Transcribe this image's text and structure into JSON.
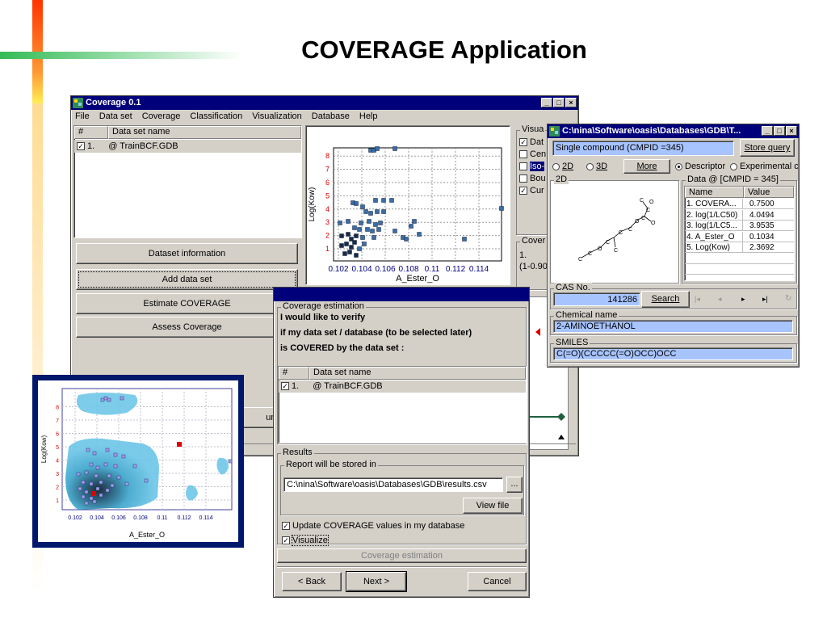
{
  "slide": {
    "title": "COVERAGE Application"
  },
  "main_window": {
    "title": "Coverage 0.1",
    "menu": [
      "File",
      "Data set",
      "Coverage",
      "Classification",
      "Visualization",
      "Database",
      "Help"
    ],
    "table": {
      "col_num": "#",
      "col_name": "Data set name",
      "row_num": "1.",
      "row_name": "@ TrainBCF.GDB"
    },
    "buttons": [
      "Dataset information",
      "Add data set",
      "Estimate COVERAGE",
      "Assess Coverage"
    ],
    "boundaries_text": "undarie",
    "plot": {
      "xlabel": "A_Ester_O",
      "ylabel": "Log(Kow)",
      "x_ticks": [
        "0.102",
        "0.104",
        "0.106",
        "0.108",
        "0.11",
        "0.112",
        "0.114"
      ],
      "y_ticks": [
        "1",
        "2",
        "3",
        "4",
        "5",
        "6",
        "7",
        "8"
      ]
    },
    "visual_panel": {
      "label": "Visua",
      "items": [
        {
          "label": "Dat",
          "checked": true
        },
        {
          "label": "Cen",
          "checked": false
        },
        {
          "label": "Iso-",
          "checked": false
        },
        {
          "label": "Bou",
          "checked": false
        },
        {
          "label": "Cur",
          "checked": true
        }
      ]
    },
    "coverage_panel": {
      "label": "Cover",
      "line1": "1.",
      "line2": "(1-0.90)"
    }
  },
  "compound_window": {
    "title": "C:\\nina\\Software\\oasis\\Databases\\GDB\\T...",
    "compound_field": "Single compound (CMPID =345)",
    "store_query": "Store query",
    "radio_2d": "2D",
    "radio_3d": "3D",
    "more": "More",
    "radio_descriptor": "Descriptor",
    "radio_experimental": "Experimental c",
    "group_2d": "2D",
    "data_group": "Data @ [CMPID = 345]",
    "data_headers": [
      "Name",
      "Value"
    ],
    "data_rows": [
      {
        "name": "1. COVERA...",
        "value": "0.7500"
      },
      {
        "name": "2. log(1/LC50)",
        "value": "4.0494"
      },
      {
        "name": "3. log(1/LC5...",
        "value": "3.9535"
      },
      {
        "name": "4. A_Ester_O",
        "value": "0.1034"
      },
      {
        "name": "5. Log(Kow)",
        "value": "2.3692"
      }
    ],
    "cas_label": "CAS No.",
    "cas_value": "141286",
    "search": "Search",
    "chem_label": "Chemical name",
    "chem_value": "2-AMINOETHANOL",
    "smiles_label": "SMILES",
    "smiles_value": "C(=O)(CCCCC(=O)OCC)OCC",
    "molecule_atoms": [
      "C",
      "C",
      "O",
      "C",
      "C",
      "C",
      "C",
      "O",
      "C",
      "O",
      "C",
      "C",
      "O"
    ]
  },
  "wizard": {
    "group_label": "Coverage estimation",
    "line1": "I would like to verify",
    "line2": "if my data set / database  (to be selected later)",
    "line3": "is COVERED by the data set :",
    "col_num": "#",
    "col_name": "Data set name",
    "row_num": "1.",
    "row_name": "@ TrainBCF.GDB",
    "results_label": "Results",
    "report_label": "Report will be stored in",
    "report_path": "C:\\nina\\Software\\oasis\\Databases\\GDB\\results.csv",
    "browse": "...",
    "view_file": "View file",
    "update_label": "Update  COVERAGE values in my database",
    "visualize_label": "Visualize",
    "estimation_button": "Coverage estimation",
    "back": "< Back",
    "next": "Next >",
    "cancel": "Cancel"
  },
  "inset_plot": {
    "xlabel": "A_Ester_O",
    "ylabel": "Log(Kow)",
    "x_ticks": [
      "0.102",
      "0.104",
      "0.106",
      "0.108",
      "0.11",
      "0.112",
      "0.114"
    ],
    "y_ticks": [
      "1",
      "2",
      "3",
      "4",
      "5",
      "6",
      "7",
      "8"
    ]
  },
  "colors": {
    "titlebar": "#00007b",
    "window": "#d4d0c8",
    "point_fill": "#3a6ea5",
    "point_dark": "#1a2a44",
    "inset_border": "#00176b",
    "blob_light": "#6ec6e8",
    "blob_dark": "#0a1a2a",
    "red_marker": "#e00000"
  }
}
